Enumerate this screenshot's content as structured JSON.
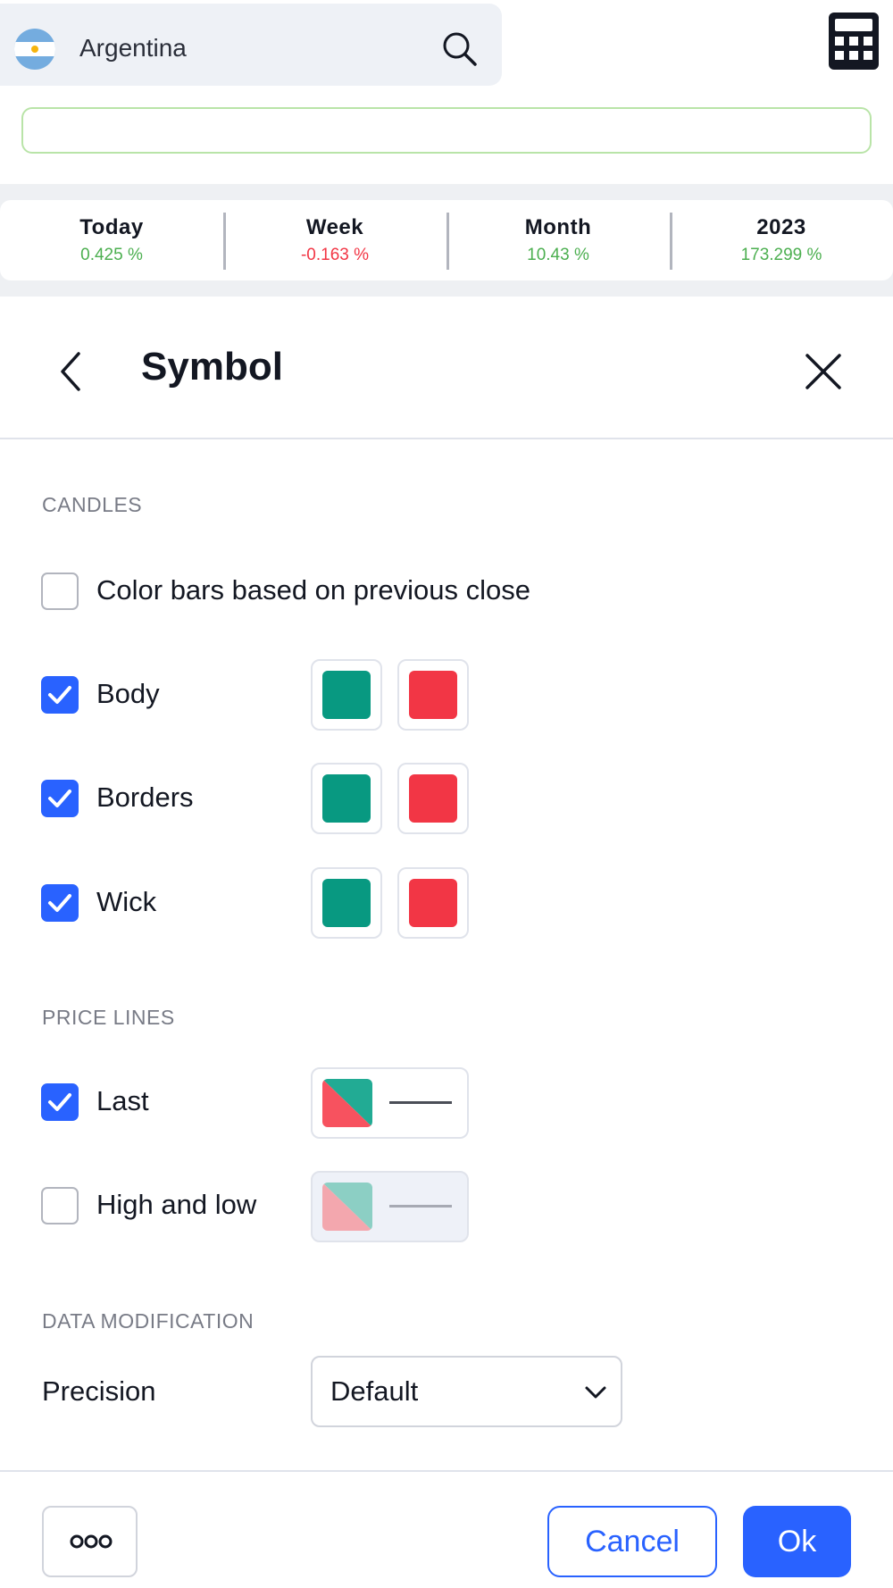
{
  "header": {
    "country": "Argentina",
    "country_flag_icon": "argentina-flag-icon",
    "search_icon": "search-icon",
    "calculator_icon": "calculator-icon"
  },
  "stats": [
    {
      "label": "Today",
      "value": "0.425 %",
      "trend": "up"
    },
    {
      "label": "Week",
      "value": "-0.163 %",
      "trend": "down"
    },
    {
      "label": "Month",
      "value": "10.43 %",
      "trend": "up"
    },
    {
      "label": "2023",
      "value": "173.299 %",
      "trend": "up"
    }
  ],
  "dialog": {
    "title": "Symbol",
    "back_icon": "chevron-left-icon",
    "close_icon": "close-icon"
  },
  "candles": {
    "title": "CANDLES",
    "color_prev_close": {
      "label": "Color bars based on previous close",
      "checked": false
    },
    "rows": [
      {
        "label": "Body",
        "checked": true,
        "up_color": "#089981",
        "down_color": "#F23645"
      },
      {
        "label": "Borders",
        "checked": true,
        "up_color": "#089981",
        "down_color": "#F23645"
      },
      {
        "label": "Wick",
        "checked": true,
        "up_color": "#089981",
        "down_color": "#F23645"
      }
    ]
  },
  "price_lines": {
    "title": "PRICE LINES",
    "rows": [
      {
        "label": "Last",
        "checked": true
      },
      {
        "label": "High and low",
        "checked": false
      }
    ]
  },
  "data_modification": {
    "title": "DATA MODIFICATION",
    "precision_label": "Precision",
    "precision_value": "Default"
  },
  "footer": {
    "more_icon": "more-dots-icon",
    "cancel": "Cancel",
    "ok": "Ok"
  },
  "colors": {
    "accent": "#2962FF",
    "positive": "#4CAF50",
    "negative": "#F23645",
    "up": "#089981",
    "down": "#F23645"
  }
}
